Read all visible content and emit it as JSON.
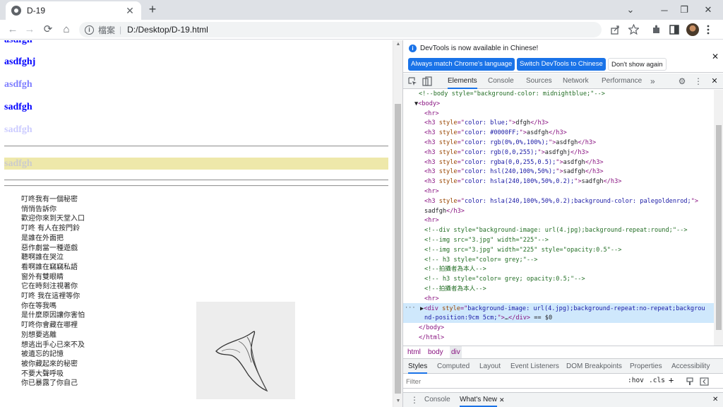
{
  "browser": {
    "tab_title": "D-19",
    "tab_close": "✕",
    "new_tab": "+",
    "window_controls": {
      "minimize": "⌄",
      "restore": "─",
      "maximize": "❐",
      "close": "✕"
    },
    "nav": {
      "back": "←",
      "forward": "→",
      "reload": "⟳",
      "home": "⌂"
    },
    "address": {
      "scheme_label": "檔案",
      "separator": "|",
      "url": "D:/Desktop/D-19.html"
    }
  },
  "page": {
    "headings": [
      {
        "text": "asdfgh",
        "color": "#0000ff"
      },
      {
        "text": "asdfghj",
        "color": "#0000ff"
      },
      {
        "text": "asdfgh",
        "color": "#7f7fff"
      },
      {
        "text": "sadfgh",
        "color": "#0000ff"
      },
      {
        "text": "sadfgh",
        "color": "#ccccff"
      },
      {
        "text": "sadfgh",
        "color": "#cccccc",
        "background": "#eee8aa"
      }
    ],
    "poem": [
      "叮咚我有一個秘密",
      "悄悄告訴你",
      "歡迎你來到天堂入口",
      "叮咚  有人在按門鈴",
      "是誰在外面把",
      "惡作劇當一種遊戲",
      "聽啊誰在哭泣",
      "看啊誰在竊竊私語",
      "窗外有雙眼睛",
      "它在時刻注視著你",
      "叮咚  我在這裡等你",
      "你在等我嗎",
      "是什麼原因讓你害怕",
      "叮咚你會藏在哪裡",
      "別想要逃離",
      "想逃出手心已來不及",
      "被遺忘的記憶",
      "被你藏起來的秘密",
      "不要大聲呼吸",
      "你已暴露了你自己"
    ]
  },
  "devtools": {
    "banner": {
      "message": "DevTools is now available in Chinese!",
      "btn_match": "Always match Chrome's language",
      "btn_switch": "Switch DevTools to Chinese",
      "btn_dismiss": "Don't show again",
      "close": "✕"
    },
    "tabs": [
      "Elements",
      "Console",
      "Sources",
      "Network",
      "Performance"
    ],
    "more_tabs": "»",
    "code_lines": [
      [
        {
          "c": "cm",
          "t": "<!--body style=\"background-color: midnightblue;\"-->"
        }
      ],
      [
        {
          "c": "tx",
          "t": "▼"
        },
        {
          "c": "tg",
          "t": "<body>"
        }
      ],
      [
        {
          "c": "tg",
          "t": "<hr>"
        }
      ],
      [
        {
          "c": "tg",
          "t": "<h3 "
        },
        {
          "c": "an",
          "t": "style"
        },
        {
          "c": "tg",
          "t": "=\""
        },
        {
          "c": "av",
          "t": "color: blue;"
        },
        {
          "c": "tg",
          "t": "\">"
        },
        {
          "c": "tx",
          "t": "dfgh"
        },
        {
          "c": "tg",
          "t": "</h3>"
        }
      ],
      [
        {
          "c": "tg",
          "t": "<h3 "
        },
        {
          "c": "an",
          "t": "style"
        },
        {
          "c": "tg",
          "t": "=\""
        },
        {
          "c": "av",
          "t": "color: #0000FF;"
        },
        {
          "c": "tg",
          "t": "\">"
        },
        {
          "c": "tx",
          "t": "asdfgh"
        },
        {
          "c": "tg",
          "t": "</h3>"
        }
      ],
      [
        {
          "c": "tg",
          "t": "<h3 "
        },
        {
          "c": "an",
          "t": "style"
        },
        {
          "c": "tg",
          "t": "=\""
        },
        {
          "c": "av",
          "t": "color: rgb(0%,0%,100%);"
        },
        {
          "c": "tg",
          "t": "\">"
        },
        {
          "c": "tx",
          "t": "asdfgh"
        },
        {
          "c": "tg",
          "t": "</h3>"
        }
      ],
      [
        {
          "c": "tg",
          "t": "<h3 "
        },
        {
          "c": "an",
          "t": "style"
        },
        {
          "c": "tg",
          "t": "=\""
        },
        {
          "c": "av",
          "t": "color: rgb(0,0,255);"
        },
        {
          "c": "tg",
          "t": "\">"
        },
        {
          "c": "tx",
          "t": "asdfghj"
        },
        {
          "c": "tg",
          "t": "</h3>"
        }
      ],
      [
        {
          "c": "tg",
          "t": "<h3 "
        },
        {
          "c": "an",
          "t": "style"
        },
        {
          "c": "tg",
          "t": "=\""
        },
        {
          "c": "av",
          "t": "color: rgba(0,0,255,0.5);"
        },
        {
          "c": "tg",
          "t": "\">"
        },
        {
          "c": "tx",
          "t": "asdfgh"
        },
        {
          "c": "tg",
          "t": "</h3>"
        }
      ],
      [
        {
          "c": "tg",
          "t": "<h3 "
        },
        {
          "c": "an",
          "t": "style"
        },
        {
          "c": "tg",
          "t": "=\""
        },
        {
          "c": "av",
          "t": "color: hsl(240,100%,50%);"
        },
        {
          "c": "tg",
          "t": "\">"
        },
        {
          "c": "tx",
          "t": "sadfgh"
        },
        {
          "c": "tg",
          "t": "</h3>"
        }
      ],
      [
        {
          "c": "tg",
          "t": "<h3 "
        },
        {
          "c": "an",
          "t": "style"
        },
        {
          "c": "tg",
          "t": "=\""
        },
        {
          "c": "av",
          "t": "color: hsla(240,100%,50%,0.2);"
        },
        {
          "c": "tg",
          "t": "\">"
        },
        {
          "c": "tx",
          "t": "sadfgh"
        },
        {
          "c": "tg",
          "t": "</h3>"
        }
      ],
      [
        {
          "c": "tg",
          "t": "<hr>"
        }
      ],
      [
        {
          "c": "tg",
          "t": "<h3 "
        },
        {
          "c": "an",
          "t": "style"
        },
        {
          "c": "tg",
          "t": "=\""
        },
        {
          "c": "av",
          "t": "color: hsla(240,100%,50%,0.2);background-color: palegoldenrod;"
        },
        {
          "c": "tg",
          "t": "\">"
        }
      ],
      [
        {
          "c": "tx",
          "t": "sadfgh"
        },
        {
          "c": "tg",
          "t": "</h3>"
        }
      ],
      [
        {
          "c": "tg",
          "t": "<hr>"
        }
      ],
      [
        {
          "c": "cm",
          "t": "<!--div style=\"background-image: url(4.jpg);background-repeat:round;\"-->"
        }
      ],
      [
        {
          "c": "cm",
          "t": "<!--img src=\"3.jpg\" width=\"225\"-->"
        }
      ],
      [
        {
          "c": "cm",
          "t": "<!--img src=\"3.jpg\" width=\"225\" style=\"opacity:0.5\"-->"
        }
      ],
      [
        {
          "c": "cm",
          "t": "<!-- h3 style=\"color= grey;\"-->"
        }
      ],
      [
        {
          "c": "cm",
          "t": "<!--拍攝者為本人-->"
        }
      ],
      [
        {
          "c": "cm",
          "t": "<!-- h3 style=\"color= grey; opacity:0.5;\"-->"
        }
      ],
      [
        {
          "c": "cm",
          "t": "<!--拍攝者為本人-->"
        }
      ],
      [
        {
          "c": "tg",
          "t": "<hr>"
        }
      ],
      [
        {
          "c": "tx",
          "t": "▶"
        },
        {
          "c": "tg",
          "t": "<div "
        },
        {
          "c": "an",
          "t": "style"
        },
        {
          "c": "tg",
          "t": "=\""
        },
        {
          "c": "av",
          "t": "background-image: url(4.jpg);background-repeat:no-repeat;backgrou"
        }
      ],
      [
        {
          "c": "av",
          "t": "nd-position:9cm 5cm;"
        },
        {
          "c": "tg",
          "t": "\">"
        },
        {
          "c": "tx",
          "t": "…"
        },
        {
          "c": "tg",
          "t": "</div>"
        },
        {
          "c": "tx",
          "t": " == $0"
        }
      ],
      [
        {
          "c": "tg",
          "t": "</body>"
        }
      ],
      [
        {
          "c": "tg",
          "t": "</html>"
        }
      ]
    ],
    "ellipsis": "···",
    "breadcrumbs": [
      "html",
      "body",
      "div"
    ],
    "styles_tabs": [
      "Styles",
      "Computed",
      "Layout",
      "Event Listeners",
      "DOM Breakpoints",
      "Properties",
      "Accessibility"
    ],
    "filter_placeholder": "Filter",
    "filter_tools": [
      ":hov",
      ".cls",
      "+"
    ],
    "drawer_tabs": [
      "Console",
      "What's New"
    ],
    "drawer_close": "✕",
    "drawer_menu": "⋮",
    "close_devtools": "✕",
    "settings_icon": "⚙",
    "kebab": "⋮"
  }
}
